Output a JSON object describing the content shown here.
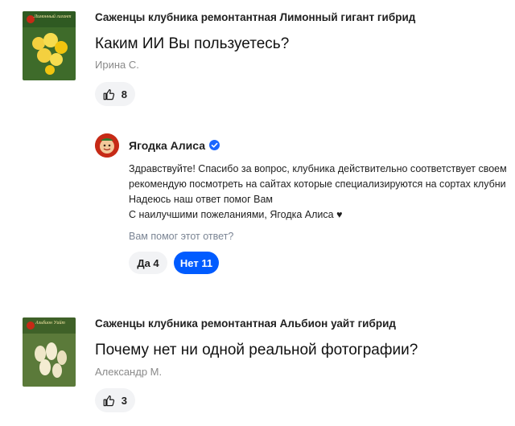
{
  "colors": {
    "accent": "#005bff",
    "verified": "#1a66ff",
    "muted": "#8a8a8a"
  },
  "questions": [
    {
      "product": "Саженцы клубника ремонтантная Лимонный гигант гибрид",
      "thumb_caption": "Лимонный гигант",
      "question": "Каким ИИ Вы пользуетесь?",
      "author": "Ирина С.",
      "likes": "8"
    },
    {
      "product": "Саженцы клубника ремонтантная Альбион уайт гибрид",
      "thumb_caption": "Альбион Уайт",
      "question": "Почему нет ни одной реальной фотографии?",
      "author": "Александр М.",
      "likes": "3"
    }
  ],
  "answer": {
    "seller": "Ягодка Алиса",
    "lines": [
      "Здравствуйте! Спасибо за вопрос, клубника действительно соответствует своем",
      "рекомендую посмотреть на сайтах которые специализируются на сортах клубни",
      "Надеюсь наш ответ помог Вам",
      "С наилучшими пожеланиями, Ягодка Алиса ♥"
    ],
    "helpful_question": "Вам помог этот ответ?",
    "yes_label": "Да 4",
    "no_label": "Нет 11"
  },
  "icons": [
    "thumbs-up-icon",
    "verified-icon",
    "heart-icon"
  ]
}
